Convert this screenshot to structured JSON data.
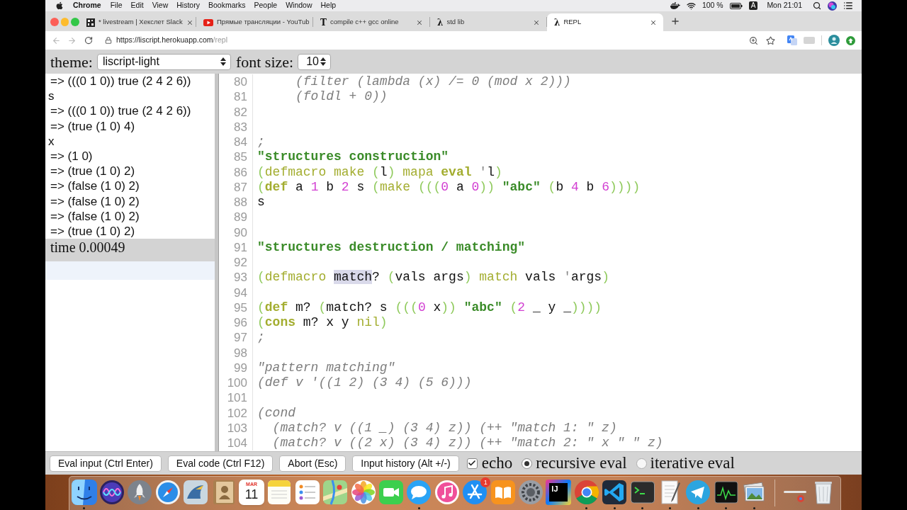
{
  "menu_bar": {
    "app": "Chrome",
    "menus": [
      "File",
      "Edit",
      "View",
      "History",
      "Bookmarks",
      "People",
      "Window",
      "Help"
    ],
    "battery": "100 %",
    "input_source": "A",
    "clock": "Mon 21:01"
  },
  "tabs": [
    {
      "title": "* livestream | Хекслет Slack",
      "favicon": {
        "kind": "grid"
      },
      "selected": false
    },
    {
      "title": "Прямые трансляции - YouTub",
      "favicon": {
        "kind": "play"
      },
      "selected": false
    },
    {
      "title": "compile c++ gcc online",
      "favicon": {
        "kind": "glyph",
        "text": "T"
      },
      "selected": false
    },
    {
      "title": "std lib",
      "favicon": {
        "kind": "glyph",
        "text": "λ"
      },
      "selected": false
    },
    {
      "title": "REPL",
      "favicon": {
        "kind": "glyph",
        "text": "λ"
      },
      "selected": true
    }
  ],
  "address_bar": {
    "url_base": "https://liscript.herokuapp.com",
    "url_path": "/repl"
  },
  "settings": {
    "theme_label": "theme:",
    "theme": "liscript-light",
    "font_size_label": "font size:",
    "font_size": "10"
  },
  "output": {
    "lines": [
      {
        "kind": "result",
        "text": "=> (((0 1 0)) true (2 4 2 6))"
      },
      {
        "kind": "input",
        "text": "s"
      },
      {
        "kind": "result",
        "text": "=> (((0 1 0)) true (2 4 2 6))"
      },
      {
        "kind": "result",
        "text": "=> (true (1 0) 4)"
      },
      {
        "kind": "input",
        "text": "x"
      },
      {
        "kind": "result",
        "text": "=> (1 0)"
      },
      {
        "kind": "result",
        "text": "=> (true (1 0) 2)"
      },
      {
        "kind": "result",
        "text": "=> (false (1 0) 2)"
      },
      {
        "kind": "result",
        "text": "=> (false (1 0) 2)"
      },
      {
        "kind": "result",
        "text": "=> (false (1 0) 2)"
      },
      {
        "kind": "result",
        "text": "=> (true (1 0) 2)"
      }
    ],
    "time": "time 0.00049"
  },
  "editor": {
    "lines": [
      {
        "number": "80",
        "tokens": [
          {
            "kind": "comment",
            "text": "     (filter (lambda (x) /= 0 (mod x 2)))"
          }
        ]
      },
      {
        "number": "81",
        "tokens": [
          {
            "kind": "comment",
            "text": "     (foldl + 0))"
          }
        ]
      },
      {
        "number": "82"
      },
      {
        "number": "83"
      },
      {
        "number": "84",
        "tokens": [
          {
            "kind": "comment",
            "text": ";"
          }
        ]
      },
      {
        "number": "85",
        "tokens": [
          {
            "kind": "string",
            "text": "\"structures construction\""
          }
        ]
      },
      {
        "number": "86",
        "tokens": [
          {
            "kind": "paren",
            "text": "("
          },
          {
            "kind": "macro",
            "text": "defmacro"
          },
          {
            "kind": "macro",
            "text": " make"
          },
          {
            "kind": "paren",
            "text": " ("
          },
          {
            "kind": "plain",
            "text": "l"
          },
          {
            "kind": "paren",
            "text": ")"
          },
          {
            "kind": "macro",
            "text": " mapa"
          },
          {
            "kind": "special",
            "text": " eval"
          },
          {
            "kind": "quote",
            "text": " '"
          },
          {
            "kind": "plain",
            "text": "l"
          },
          {
            "kind": "paren",
            "text": ")"
          }
        ]
      },
      {
        "number": "87",
        "tokens": [
          {
            "kind": "paren",
            "text": "("
          },
          {
            "kind": "special",
            "text": "def"
          },
          {
            "kind": "plain",
            "text": " a "
          },
          {
            "kind": "number",
            "text": "1"
          },
          {
            "kind": "plain",
            "text": " b "
          },
          {
            "kind": "number",
            "text": "2"
          },
          {
            "kind": "plain",
            "text": " s "
          },
          {
            "kind": "paren",
            "text": "("
          },
          {
            "kind": "macro",
            "text": "make"
          },
          {
            "kind": "paren",
            "text": " ((("
          },
          {
            "kind": "number",
            "text": "0"
          },
          {
            "kind": "plain",
            "text": " a "
          },
          {
            "kind": "number",
            "text": "0"
          },
          {
            "kind": "paren",
            "text": "))"
          },
          {
            "kind": "string",
            "text": " \"abc\""
          },
          {
            "kind": "paren",
            "text": " ("
          },
          {
            "kind": "plain",
            "text": "b "
          },
          {
            "kind": "number",
            "text": "4"
          },
          {
            "kind": "plain",
            "text": " b "
          },
          {
            "kind": "number",
            "text": "6"
          },
          {
            "kind": "paren",
            "text": "))))"
          }
        ]
      },
      {
        "number": "88",
        "tokens": [
          {
            "kind": "plain",
            "text": "s"
          }
        ]
      },
      {
        "number": "89"
      },
      {
        "number": "90"
      },
      {
        "number": "91",
        "tokens": [
          {
            "kind": "string",
            "text": "\"structures destruction / matching\""
          }
        ]
      },
      {
        "number": "92"
      },
      {
        "number": "93",
        "tokens": [
          {
            "kind": "paren",
            "text": "("
          },
          {
            "kind": "macro",
            "text": "defmacro "
          },
          {
            "kind": "selection",
            "text": "match"
          },
          {
            "kind": "plain",
            "text": "? "
          },
          {
            "kind": "paren",
            "text": "("
          },
          {
            "kind": "plain",
            "text": "vals args"
          },
          {
            "kind": "paren",
            "text": ")"
          },
          {
            "kind": "macro",
            "text": " match"
          },
          {
            "kind": "plain",
            "text": " vals "
          },
          {
            "kind": "quote",
            "text": "'"
          },
          {
            "kind": "plain",
            "text": "args"
          },
          {
            "kind": "paren",
            "text": ")"
          }
        ]
      },
      {
        "number": "94"
      },
      {
        "number": "95",
        "tokens": [
          {
            "kind": "paren",
            "text": "("
          },
          {
            "kind": "special",
            "text": "def"
          },
          {
            "kind": "plain",
            "text": " m? "
          },
          {
            "kind": "paren",
            "text": "("
          },
          {
            "kind": "plain",
            "text": "match? s "
          },
          {
            "kind": "paren",
            "text": "((("
          },
          {
            "kind": "number",
            "text": "0"
          },
          {
            "kind": "plain",
            "text": " x"
          },
          {
            "kind": "paren",
            "text": "))"
          },
          {
            "kind": "string",
            "text": " \"abc\""
          },
          {
            "kind": "paren",
            "text": " ("
          },
          {
            "kind": "number",
            "text": "2"
          },
          {
            "kind": "plain",
            "text": " _ y _"
          },
          {
            "kind": "paren",
            "text": "))))"
          }
        ]
      },
      {
        "number": "96",
        "tokens": [
          {
            "kind": "paren",
            "text": "("
          },
          {
            "kind": "special",
            "text": "cons"
          },
          {
            "kind": "plain",
            "text": " m? x y "
          },
          {
            "kind": "macro",
            "text": "nil"
          },
          {
            "kind": "paren",
            "text": ")"
          }
        ]
      },
      {
        "number": "97",
        "tokens": [
          {
            "kind": "comment",
            "text": ";"
          }
        ]
      },
      {
        "number": "98"
      },
      {
        "number": "99",
        "tokens": [
          {
            "kind": "comment",
            "text": "\"pattern matching\""
          }
        ]
      },
      {
        "number": "100",
        "tokens": [
          {
            "kind": "comment",
            "text": "(def v '((1 2) (3 4) (5 6)))"
          }
        ]
      },
      {
        "number": "101"
      },
      {
        "number": "102",
        "tokens": [
          {
            "kind": "comment",
            "text": "(cond"
          }
        ]
      },
      {
        "number": "103",
        "tokens": [
          {
            "kind": "comment",
            "text": "  (match? v ((1 _) (3 4) z)) (++ \"match 1: \" z)"
          }
        ]
      },
      {
        "number": "104",
        "tokens": [
          {
            "kind": "comment",
            "text": "  (match? v ((2 x) (3 4) z)) (++ \"match 2: \" x \" \" z)"
          }
        ]
      }
    ]
  },
  "controls": {
    "buttons": [
      "Eval input (Ctrl Enter)",
      "Eval code (Ctrl F12)",
      "Abort (Esc)",
      "Input history (Alt +/-)"
    ],
    "echo": {
      "label": "echo",
      "checked": true
    },
    "eval_modes": [
      {
        "label": "recursive eval",
        "selected": true
      },
      {
        "label": "iterative eval",
        "selected": false
      }
    ]
  },
  "dock": {
    "apps": [
      {
        "kind": "finder",
        "running": true
      },
      {
        "kind": "siri",
        "running": false
      },
      {
        "kind": "launchpad",
        "running": false
      },
      {
        "kind": "safari",
        "running": false
      },
      {
        "kind": "image_capture",
        "running": false
      },
      {
        "kind": "contacts",
        "running": false
      },
      {
        "kind": "calendar",
        "month": "MAR",
        "day": "11",
        "running": false
      },
      {
        "kind": "notes",
        "running": false
      },
      {
        "kind": "reminders",
        "running": false
      },
      {
        "kind": "maps",
        "running": false
      },
      {
        "kind": "photos",
        "running": false
      },
      {
        "kind": "facetime",
        "running": false
      },
      {
        "kind": "messages",
        "running": true
      },
      {
        "kind": "music",
        "running": false
      },
      {
        "kind": "app_store",
        "badge": "1",
        "running": false
      },
      {
        "kind": "books",
        "running": false
      },
      {
        "kind": "preferences",
        "running": false
      },
      {
        "kind": "ide",
        "label": "IJ",
        "running": false
      },
      {
        "kind": "chrome",
        "running": true
      },
      {
        "kind": "code_editor",
        "running": true
      },
      {
        "kind": "terminal",
        "running": true
      },
      {
        "kind": "text_editor",
        "running": true
      },
      {
        "kind": "telegram",
        "running": true
      },
      {
        "kind": "activity_monitor",
        "running": true
      },
      {
        "kind": "preview",
        "running": true
      }
    ],
    "stacks": [
      {
        "kind": "downloads"
      },
      {
        "kind": "trash"
      }
    ]
  }
}
